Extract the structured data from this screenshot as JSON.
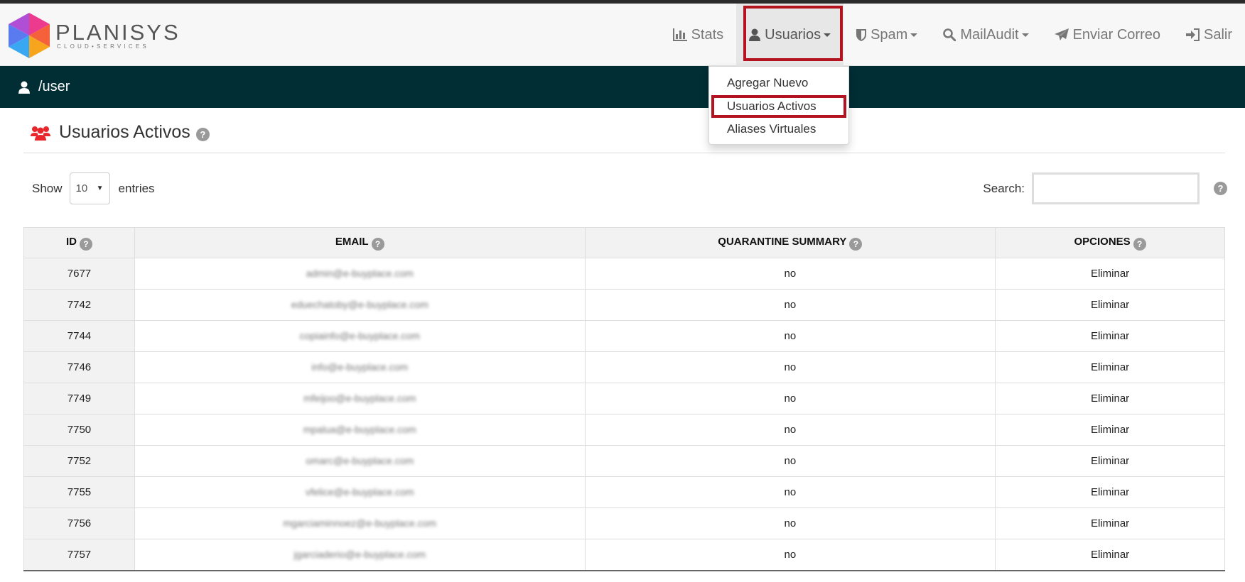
{
  "brand": {
    "name": "PLANISYS",
    "subtitle": "CLOUD•SERVICES"
  },
  "nav": {
    "items": [
      {
        "id": "stats",
        "label": "Stats",
        "icon": "bar-chart-icon",
        "caret": false
      },
      {
        "id": "usuarios",
        "label": "Usuarios",
        "icon": "user-icon",
        "caret": true,
        "active": true
      },
      {
        "id": "spam",
        "label": "Spam",
        "icon": "shield-icon",
        "caret": true
      },
      {
        "id": "mailaudit",
        "label": "MailAudit",
        "icon": "search-icon",
        "caret": true
      },
      {
        "id": "enviar",
        "label": "Enviar Correo",
        "icon": "paper-plane-icon",
        "caret": false
      },
      {
        "id": "salir",
        "label": "Salir",
        "icon": "sign-in-icon",
        "caret": false
      }
    ]
  },
  "path": "/user",
  "dropdown": {
    "items": [
      "Agregar Nuevo",
      "Usuarios Activos",
      "Aliases Virtuales"
    ]
  },
  "page": {
    "title": "Usuarios Activos"
  },
  "controls": {
    "show_label": "Show",
    "entries_value": "10",
    "entries_label": "entries",
    "search_label": "Search:",
    "search_value": ""
  },
  "table": {
    "headers": [
      "ID",
      "EMAIL",
      "QUARANTINE SUMMARY",
      "OPCIONES"
    ],
    "rows": [
      {
        "id": "7677",
        "email": "admin@e-buyplace.com",
        "quarantine": "no",
        "option": "Eliminar"
      },
      {
        "id": "7742",
        "email": "eduechatoby@e-buyplace.com",
        "quarantine": "no",
        "option": "Eliminar"
      },
      {
        "id": "7744",
        "email": "copiainfo@e-buyplace.com",
        "quarantine": "no",
        "option": "Eliminar"
      },
      {
        "id": "7746",
        "email": "info@e-buyplace.com",
        "quarantine": "no",
        "option": "Eliminar"
      },
      {
        "id": "7749",
        "email": "mfeijoo@e-buyplace.com",
        "quarantine": "no",
        "option": "Eliminar"
      },
      {
        "id": "7750",
        "email": "mpalua@e-buyplace.com",
        "quarantine": "no",
        "option": "Eliminar"
      },
      {
        "id": "7752",
        "email": "omarc@e-buyplace.com",
        "quarantine": "no",
        "option": "Eliminar"
      },
      {
        "id": "7755",
        "email": "vfelice@e-buyplace.com",
        "quarantine": "no",
        "option": "Eliminar"
      },
      {
        "id": "7756",
        "email": "mgarciaminnoez@e-buyplace.com",
        "quarantine": "no",
        "option": "Eliminar"
      },
      {
        "id": "7757",
        "email": "jgarciaderio@e-buyplace.com",
        "quarantine": "no",
        "option": "Eliminar"
      }
    ]
  },
  "colors": {
    "highlight": "#b3121f",
    "pathbar": "#012d35",
    "icon_red": "#e8262c"
  }
}
